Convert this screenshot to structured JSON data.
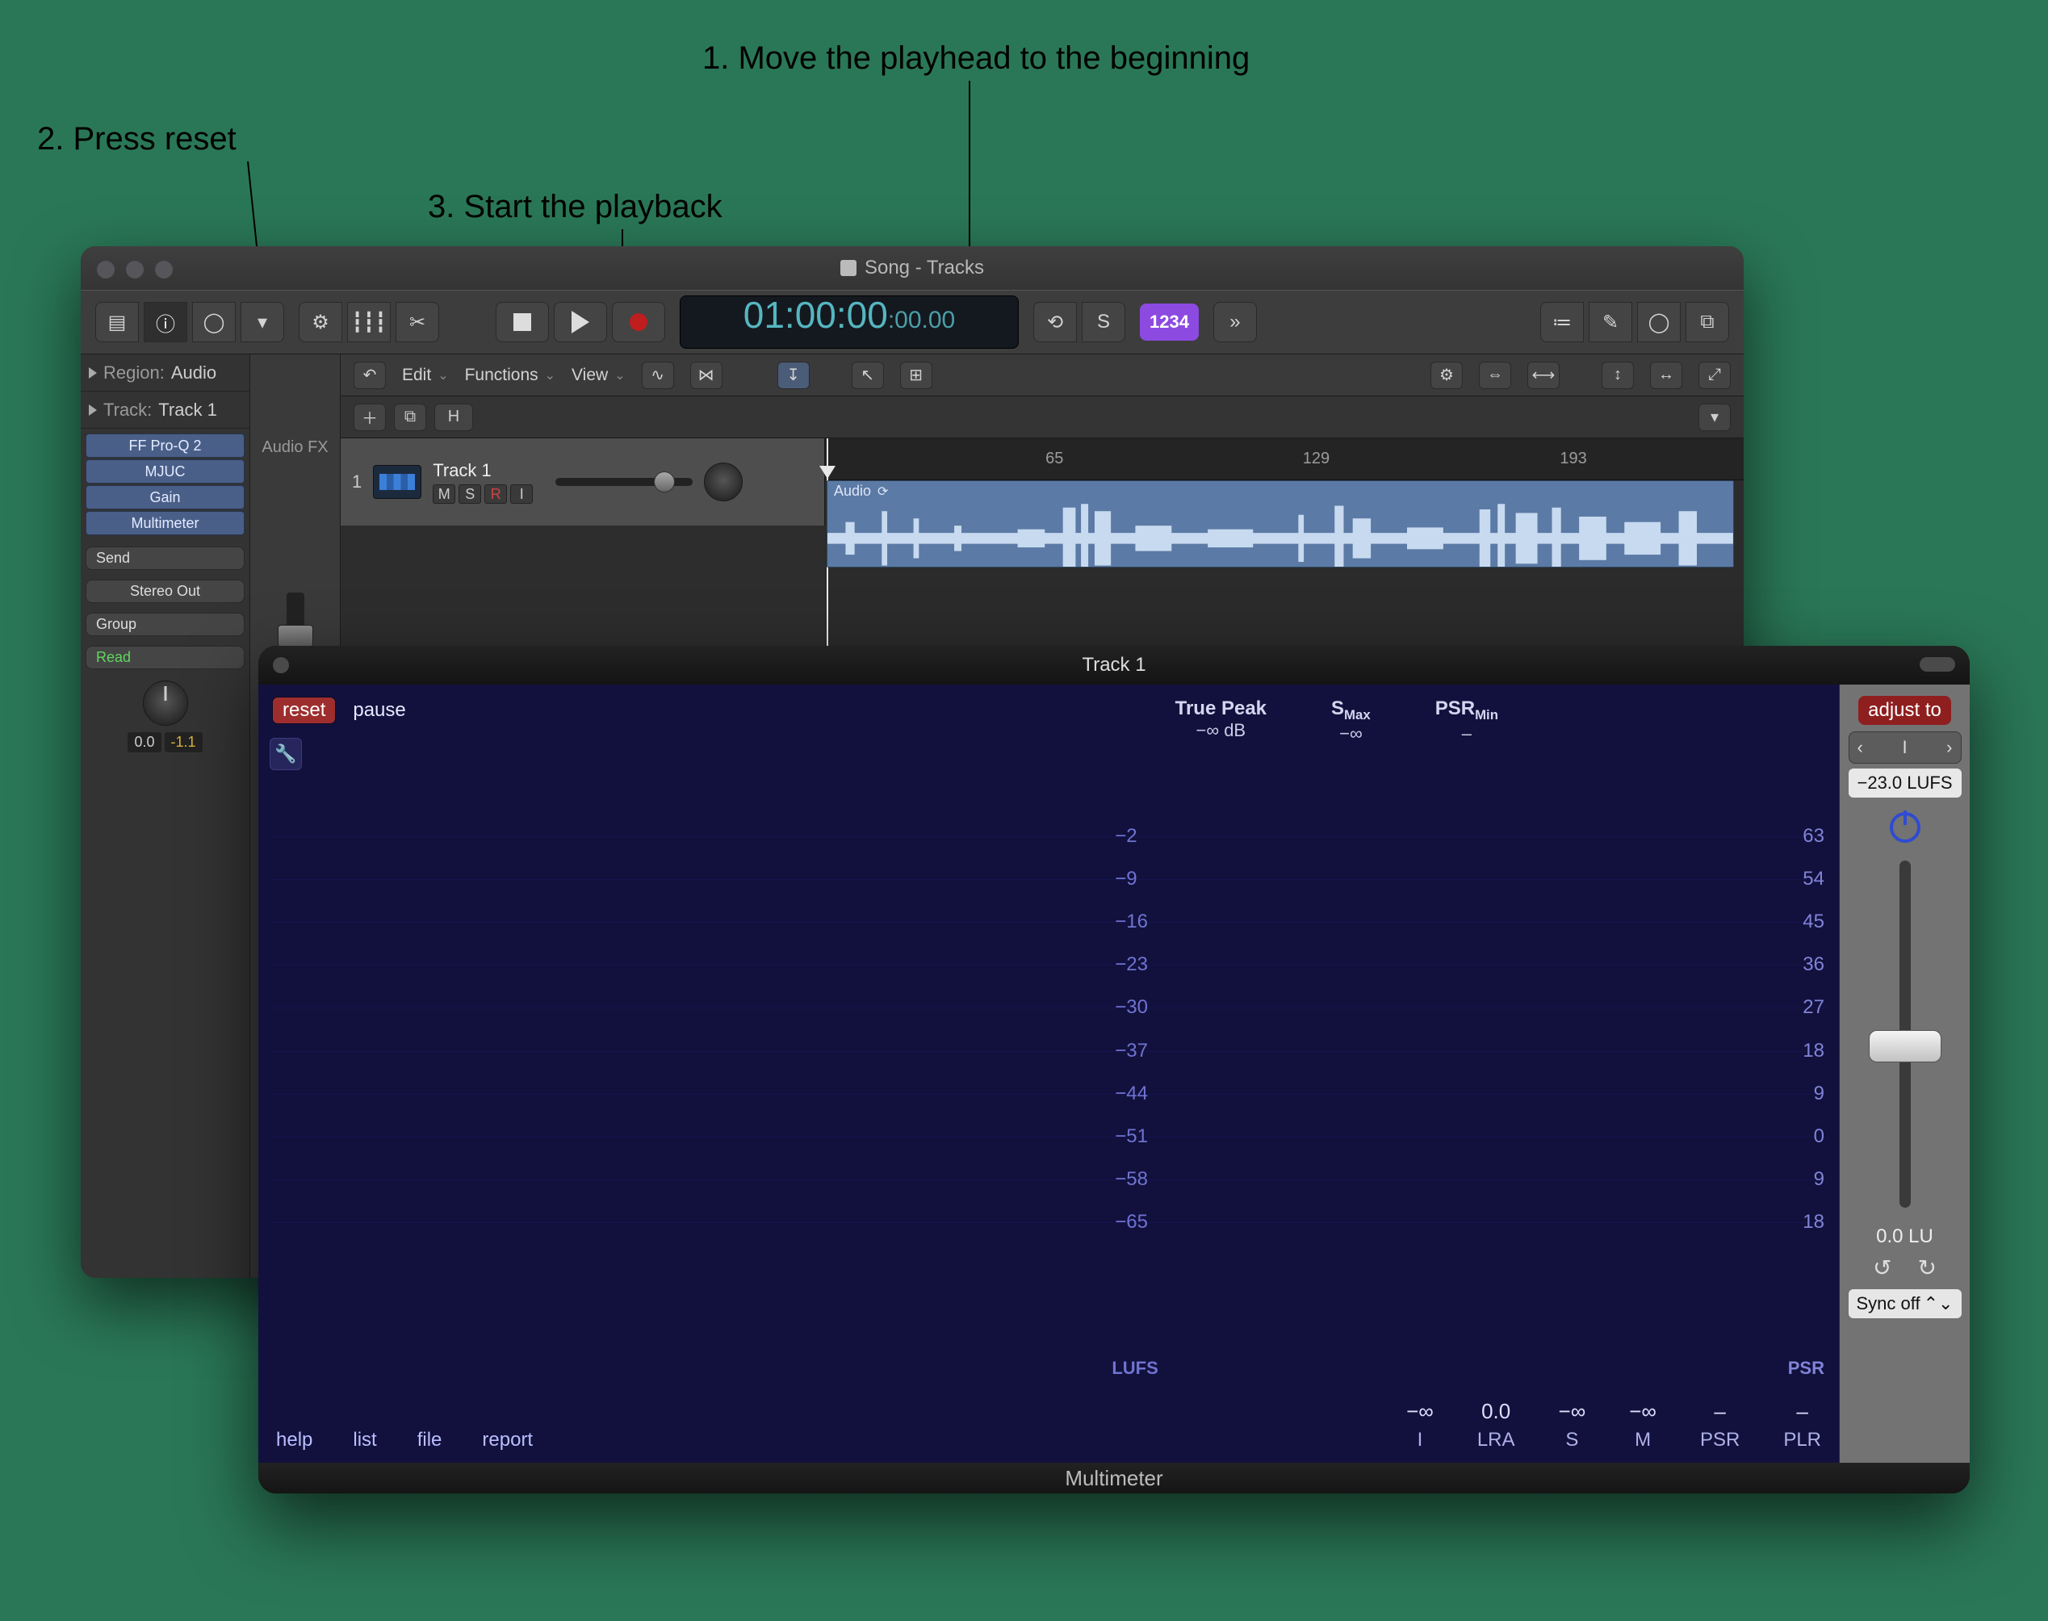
{
  "annotations": {
    "step1": "1. Move the playhead to the beginning",
    "step2": "2. Press reset",
    "step3": "3. Start the playback"
  },
  "logic": {
    "window_title": "Song - Tracks",
    "timecode_main": "01:00:00",
    "timecode_sub": ":00.00",
    "mode_chip": "1234",
    "inspector": {
      "region_label": "Region:",
      "region_value": "Audio",
      "track_label": "Track:",
      "track_value": "Track 1",
      "inserts": [
        "FF Pro-Q 2",
        "MJUC",
        "Gain",
        "Multimeter"
      ],
      "audiofx_label": "Audio FX",
      "send_label": "Send",
      "stereo_out": "Stereo Out",
      "group_label": "Group",
      "read_label": "Read",
      "val_left": "0.0",
      "val_right": "-1.1",
      "ir_i": "I",
      "ir_r": "R",
      "m_label": "M",
      "s_label": "S",
      "mix_track_label": "Track 1"
    },
    "tracks_tb": {
      "edit": "Edit",
      "functions": "Functions",
      "view": "View"
    },
    "ruler": {
      "t1": "65",
      "t2": "129",
      "t3": "193"
    },
    "track": {
      "number": "1",
      "name": "Track 1",
      "m": "M",
      "s": "S",
      "r": "R",
      "i": "I",
      "region_name": "Audio"
    }
  },
  "mm": {
    "title": "Track 1",
    "footer": "Multimeter",
    "reset": "reset",
    "pause": "pause",
    "hdr_tp_label": "True Peak",
    "hdr_tp_val": "−∞ dB",
    "hdr_smax_label_pre": "S",
    "hdr_smax_label_suf": "Max",
    "hdr_smax_val": "−∞",
    "hdr_psrmin_label_pre": "PSR",
    "hdr_psrmin_label_suf": "Min",
    "hdr_psrmin_val": "–",
    "lufs_axis": [
      "−2",
      "−9",
      "−16",
      "−23",
      "−30",
      "−37",
      "−44",
      "−51",
      "−58",
      "−65"
    ],
    "psr_axis": [
      "63",
      "54",
      "45",
      "36",
      "27",
      "18",
      "9",
      "0",
      "9",
      "18"
    ],
    "lufs_tag": "LUFS",
    "psr_tag": "PSR",
    "menu": {
      "help": "help",
      "list": "list",
      "file": "file",
      "report": "report"
    },
    "readouts": {
      "i": {
        "v": "−∞",
        "l": "I"
      },
      "lra": {
        "v": "0.0",
        "l": "LRA"
      },
      "s": {
        "v": "−∞",
        "l": "S"
      },
      "m": {
        "v": "−∞",
        "l": "M"
      },
      "psr": {
        "v": "–",
        "l": "PSR"
      },
      "plr": {
        "v": "–",
        "l": "PLR"
      }
    },
    "side": {
      "adjust": "adjust to",
      "stepper_value": "I",
      "lufs_field": "−23.0 LUFS",
      "lu_value": "0.0 LU",
      "sync": "Sync off"
    }
  }
}
